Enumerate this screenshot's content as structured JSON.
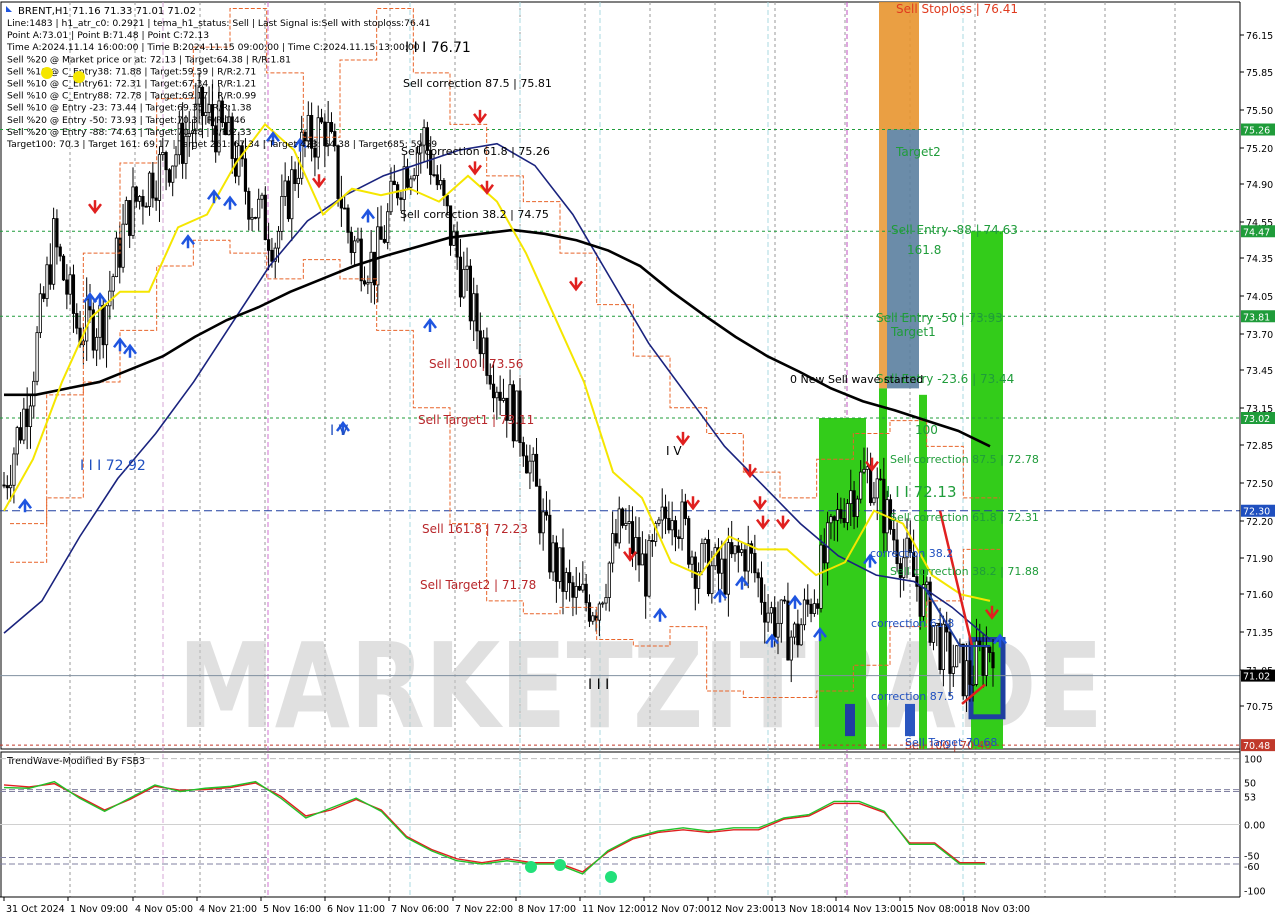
{
  "symbol_header": "BRENT,H1  71.16 71.33 71.01 71.02",
  "info_lines": [
    "Line:1483 | h1_atr_c0: 0.2921 | tema_h1_status: Sell | Last Signal is:Sell with stoploss:76.41",
    "Point A:73.01 | Point B:71.48 | Point C:72.13",
    "Time A:2024.11.14 16:00:00 | Time B:2024.11.15 09:00:00 | Time C:2024.11.15 13:00:00",
    "Sell %20 @ Market price or at: 72.13 | Target:64.38 | R/R:1.81",
    "Sell %10 @ C_Entry38: 71.88 | Target:59.59 | R/R:2.71",
    "Sell %10 @ C_Entry61: 72.31 | Target:67.34 | R/R:1.21",
    "Sell %10 @ C_Entry88: 72.78 | Target:69.17 | R/R:0.99",
    "Sell %10 @ Entry -23: 73.44 | Target:69.35 | R/R:1.38",
    "Sell %20 @ Entry -50: 73.93 | Target:70.3 | R/R:1.46",
    "Sell %20 @ Entry -88: 74.63 | Target:70.48 | R/R:2.33",
    "Target100: 70.3 | Target 161: 69.17 | Target 261: 67.34 | Target 423: 64.38 | Target685: 59.59"
  ],
  "watermark": "MARKETZITRADE",
  "price_axis_ticks": [
    "76.15",
    "75.85",
    "75.50",
    "75.20",
    "74.90",
    "74.55",
    "74.35",
    "74.05",
    "73.70",
    "73.45",
    "73.15",
    "72.85",
    "72.50",
    "72.20",
    "71.90",
    "71.60",
    "71.35",
    "71.05",
    "70.75"
  ],
  "price_level_badges": [
    {
      "label": "75.26",
      "color": "#1f9c3a"
    },
    {
      "label": "74.47",
      "color": "#1f9c3a"
    },
    {
      "label": "73.81",
      "color": "#1f9c3a"
    },
    {
      "label": "73.02",
      "color": "#1f9c3a"
    },
    {
      "label": "72.30",
      "color": "#1f4fbf"
    },
    {
      "label": "71.02",
      "color": "#000000"
    },
    {
      "label": "70.48",
      "color": "#c0392b"
    }
  ],
  "chart_labels": [
    {
      "text": "Sell Stoploss | 76.41",
      "color": "#e03b1f"
    },
    {
      "text": "Target2",
      "color": "#1f9c3a"
    },
    {
      "text": "Sell Entry -88 | 74.63",
      "color": "#1f9c3a"
    },
    {
      "text": "161.8",
      "color": "#1f9c3a"
    },
    {
      "text": "Sell Entry -50 | 73.93",
      "color": "#1f9c3a"
    },
    {
      "text": "Target1",
      "color": "#1f9c3a"
    },
    {
      "text": "Sell Entry -23.6 | 73.44",
      "color": "#1f9c3a"
    },
    {
      "text": "0 New Sell wave started",
      "color": "#000000"
    },
    {
      "text": "100",
      "color": "#1f9c3a"
    },
    {
      "text": "Sell correction 87.5 | 72.78",
      "color": "#1f9c3a"
    },
    {
      "text": "I I I 72.13",
      "color": "#1f9c3a"
    },
    {
      "text": "Sell correction 61.8 | 72.31",
      "color": "#1f9c3a"
    },
    {
      "text": "Sell correction 38.2 | 71.88",
      "color": "#1f9c3a"
    },
    {
      "text": "correction 38.2",
      "color": "#1f4fbf"
    },
    {
      "text": "correction 61.8",
      "color": "#1f4fbf"
    },
    {
      "text": "correction 87.5",
      "color": "#1f4fbf"
    },
    {
      "text": "Sell 100 | 73.56",
      "color": "#b8272b"
    },
    {
      "text": "Sell Target1 | 73.11",
      "color": "#b8272b"
    },
    {
      "text": "Sell 161.8 | 72.23",
      "color": "#b8272b"
    },
    {
      "text": "Sell Target2 | 71.78",
      "color": "#b8272b"
    },
    {
      "text": "I I I 76.71",
      "color": "#000000"
    },
    {
      "text": "Sell correction 87.5 | 75.81",
      "color": "#000000"
    },
    {
      "text": "Sell correction 61.8 | 75.26",
      "color": "#000000"
    },
    {
      "text": "Sell correction 38.2 | 74.75",
      "color": "#000000"
    },
    {
      "text": "I I I 72.92",
      "color": "#1f4fbf"
    },
    {
      "text": "I V",
      "color": "#1f4fbf"
    },
    {
      "text": "I V",
      "color": "#000000"
    },
    {
      "text": "I I I",
      "color": "#000000"
    },
    {
      "text": "Sell 100 | 70.48",
      "color": "#c0392b"
    },
    {
      "text": "Sell Target 70.68",
      "color": "#1f4fbf"
    }
  ],
  "time_axis_labels": [
    "31 Oct 2024",
    "1 Nov 09:00",
    "4 Nov 05:00",
    "4 Nov 21:00",
    "5 Nov 16:00",
    "6 Nov 11:00",
    "7 Nov 06:00",
    "7 Nov 22:00",
    "8 Nov 17:00",
    "11 Nov 12:00",
    "12 Nov 07:00",
    "12 Nov 23:00",
    "13 Nov 18:00",
    "14 Nov 13:00",
    "15 Nov 08:00",
    "18 Nov 03:00"
  ],
  "indicator": {
    "title": "TrendWave-Modified By FSB3",
    "ticks": [
      "100",
      "50",
      "53",
      "0.00",
      "-50",
      "-60",
      "-100"
    ]
  },
  "colors": {
    "bull_candle": "#000000",
    "bear_candle": "#000000",
    "ema_fast": "#1a237e",
    "ema_slow": "#000000",
    "signal_line": "#f5e600",
    "zone_green": "#33cc1a",
    "zone_orange": "#e8952f",
    "zone_steel": "#5b7fa0",
    "arrow_up": "#1f55e0",
    "arrow_down": "#e0201f",
    "wave_green": "#22c22a",
    "wave_red": "#e02020"
  },
  "chart_data": {
    "type": "line",
    "title": "BRENT,H1",
    "ylim": [
      70.45,
      76.25
    ],
    "indicator_ylim": [
      -110,
      110
    ],
    "last_price": 71.02,
    "key_levels": [
      76.41,
      75.26,
      74.47,
      73.81,
      73.02,
      72.3,
      71.02,
      70.48
    ],
    "ema_slow": [
      73.2,
      73.2,
      73.25,
      73.3,
      73.4,
      73.5,
      73.65,
      73.78,
      73.88,
      74.0,
      74.1,
      74.2,
      74.28,
      74.35,
      74.42,
      74.45,
      74.48,
      74.45,
      74.4,
      74.32,
      74.2,
      74.0,
      73.82,
      73.65,
      73.5,
      73.38,
      73.25,
      73.15,
      73.08,
      73.0,
      72.92,
      72.8
    ],
    "ema_fast": [
      71.35,
      71.6,
      72.1,
      72.55,
      72.9,
      73.3,
      73.75,
      74.2,
      74.55,
      74.75,
      74.9,
      75.0,
      75.1,
      75.15,
      74.98,
      74.6,
      74.1,
      73.6,
      73.2,
      72.8,
      72.5,
      72.2,
      71.95,
      71.8,
      71.75,
      71.55,
      71.3
    ],
    "candle_close_path": [
      72.5,
      73.2,
      74.4,
      73.7,
      73.8,
      74.6,
      74.9,
      75.1,
      75.4,
      75.2,
      74.7,
      74.4,
      75.1,
      75.3,
      74.4,
      74.2,
      74.9,
      75.2,
      74.5,
      73.8,
      73.3,
      72.9,
      72.0,
      71.6,
      71.6,
      72.2,
      71.8,
      72.4,
      71.9,
      71.8,
      72.0,
      71.5,
      71.3,
      71.8,
      72.4,
      72.6,
      72.1,
      71.7,
      71.2,
      71.0,
      71.3
    ],
    "signal_line": [
      72.3,
      72.7,
      73.3,
      73.8,
      74.0,
      74.0,
      74.5,
      74.6,
      75.0,
      75.3,
      75.1,
      74.6,
      74.8,
      74.75,
      74.8,
      74.7,
      74.9,
      74.7,
      74.3,
      73.8,
      73.3,
      72.6,
      72.4,
      71.9,
      71.8,
      72.1,
      72.0,
      72.0,
      71.8,
      71.9,
      72.3,
      72.2,
      71.8,
      71.65,
      71.6
    ],
    "oscillator_green": [
      56,
      55,
      65,
      40,
      20,
      40,
      60,
      50,
      55,
      58,
      65,
      40,
      10,
      25,
      40,
      20,
      -20,
      -40,
      -55,
      -60,
      -55,
      -60,
      -60,
      -75,
      -40,
      -20,
      -10,
      -5,
      -10,
      -5,
      -5,
      10,
      15,
      35,
      35,
      20,
      -30,
      -30,
      -60,
      -60
    ],
    "oscillator_red": [
      60,
      57,
      62,
      42,
      22,
      38,
      58,
      52,
      53,
      56,
      63,
      43,
      13,
      22,
      38,
      22,
      -18,
      -38,
      -52,
      -58,
      -52,
      -58,
      -58,
      -72,
      -42,
      -22,
      -12,
      -8,
      -12,
      -8,
      -8,
      8,
      13,
      32,
      32,
      18,
      -28,
      -28,
      -58,
      -58
    ]
  }
}
